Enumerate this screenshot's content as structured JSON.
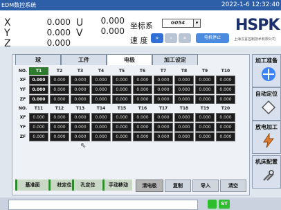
{
  "titlebar": {
    "app": "EDM数控系统",
    "datetime": "2022-1-6 12:32:40"
  },
  "axes": [
    {
      "name": "X",
      "value": "0.000"
    },
    {
      "name": "Y",
      "value": "0.000"
    },
    {
      "name": "Z",
      "value": "0.000"
    },
    {
      "name": "U",
      "value": "0.000"
    },
    {
      "name": "V",
      "value": "0.000"
    }
  ],
  "coordsys": {
    "label": "坐标系",
    "value": "G054",
    "arrow": "▾"
  },
  "speed": {
    "label": "速 度",
    "btn1": "»",
    "btn2": "›",
    "btn3": "»",
    "mode": "电机停止"
  },
  "logo": {
    "brand": "HSPK",
    "subtitle": "上海汉喜控制技术有限公司"
  },
  "tabs": [
    "球",
    "工件",
    "电极",
    "加工设定"
  ],
  "table": {
    "header1": [
      "NO.",
      "T1",
      "T2",
      "T3",
      "T4",
      "T5",
      "T6",
      "T7",
      "T8",
      "T9",
      "T10"
    ],
    "header2": [
      "NO.",
      "T11",
      "T12",
      "T13",
      "T14",
      "T15",
      "T16",
      "T17",
      "T18",
      "T19",
      "T20"
    ],
    "row_labels": [
      "XF",
      "YF",
      "ZF"
    ],
    "cell_value": "0.000"
  },
  "bottom_buttons": [
    "基准面",
    "柱定位",
    "孔定位",
    "手动移动",
    "清电极",
    "复制",
    "导入",
    "清空"
  ],
  "side_buttons": [
    "加工准备",
    "自动定位",
    "放电加工",
    "机床配置"
  ],
  "status": {
    "badge": "ST"
  },
  "colors": {
    "titlebar": "#2d5fa8",
    "highlight": "#2f7a2f",
    "cell": "#1c1c1c",
    "status_green": "#2ebd2e"
  }
}
